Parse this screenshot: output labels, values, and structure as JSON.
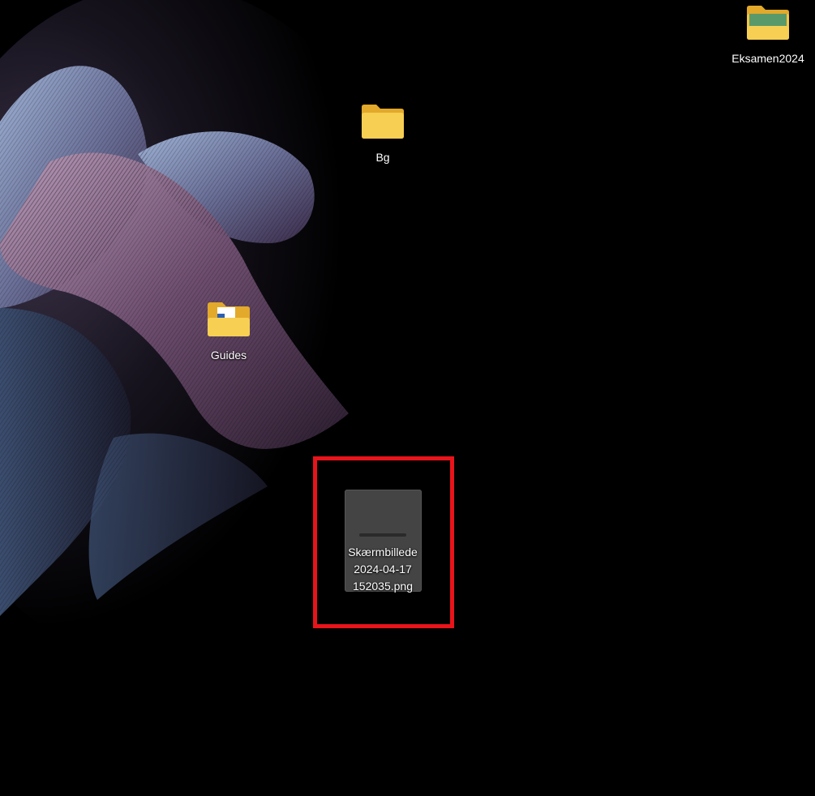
{
  "desktop": {
    "icons": [
      {
        "label": "Eksamen2024",
        "type": "folder",
        "icon": "folder-icon"
      },
      {
        "label": "Bg",
        "type": "folder",
        "icon": "folder-icon"
      },
      {
        "label": "Guides",
        "type": "folder",
        "icon": "folder-with-document-icon"
      },
      {
        "label": "Skærmbillede\n2024-04-17\n152035.png",
        "type": "png-file",
        "icon": "image-file-icon"
      }
    ]
  },
  "colors": {
    "background": "#000000",
    "folder": "#f5c542",
    "highlight": "#e8141a"
  }
}
